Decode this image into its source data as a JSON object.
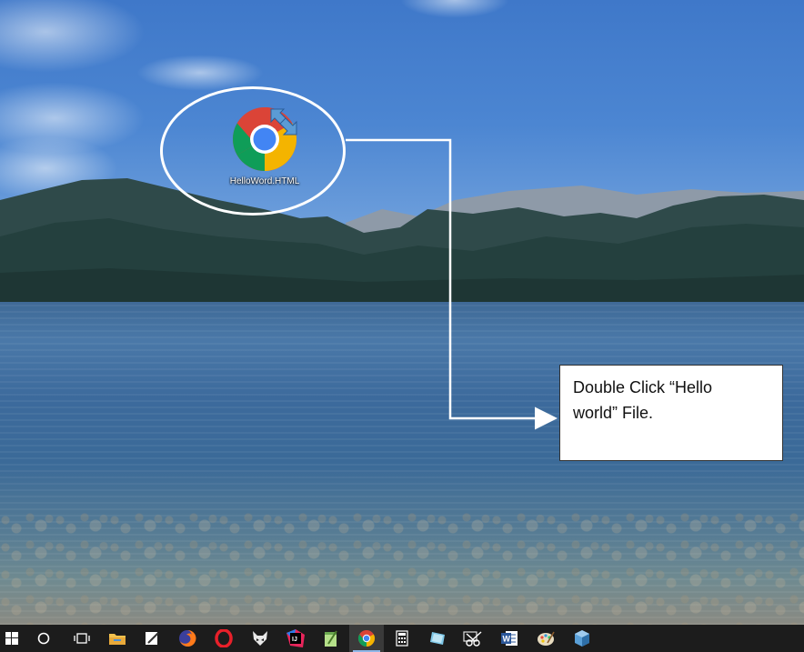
{
  "desktop": {
    "icons": [
      {
        "label": "HelloWord.HTML",
        "icon": "chrome-icon"
      }
    ]
  },
  "callout": {
    "text_line1": "Double Click “Hello",
    "text_line2": "world” File."
  },
  "taskbar": {
    "items": [
      {
        "name": "start-button",
        "icon": "windows-logo-icon"
      },
      {
        "name": "cortana-button",
        "icon": "circle-search-icon"
      },
      {
        "name": "task-view-button",
        "icon": "task-view-icon"
      },
      {
        "name": "file-explorer",
        "icon": "folder-icon"
      },
      {
        "name": "notepad-app",
        "icon": "pen-paper-icon"
      },
      {
        "name": "firefox-app",
        "icon": "firefox-icon"
      },
      {
        "name": "opera-app",
        "icon": "opera-icon"
      },
      {
        "name": "foxit-app",
        "icon": "fox-icon"
      },
      {
        "name": "intellij-app",
        "icon": "intellij-icon"
      },
      {
        "name": "notepadpp-app",
        "icon": "notepadpp-icon"
      },
      {
        "name": "chrome-app",
        "icon": "chrome-icon",
        "active": true
      },
      {
        "name": "calculator-app",
        "icon": "calculator-icon"
      },
      {
        "name": "paint3d-app",
        "icon": "tablet-icon"
      },
      {
        "name": "snipping-tool",
        "icon": "scissors-icon"
      },
      {
        "name": "word-app",
        "icon": "word-icon"
      },
      {
        "name": "paint-app",
        "icon": "palette-icon"
      },
      {
        "name": "virtualbox-app",
        "icon": "cube-icon"
      }
    ]
  },
  "colors": {
    "taskbar_bg": "#1c1c1c",
    "chrome_red": "#db4437",
    "chrome_green": "#0f9d58",
    "chrome_yellow": "#f4b400",
    "chrome_blue": "#4285f4"
  }
}
